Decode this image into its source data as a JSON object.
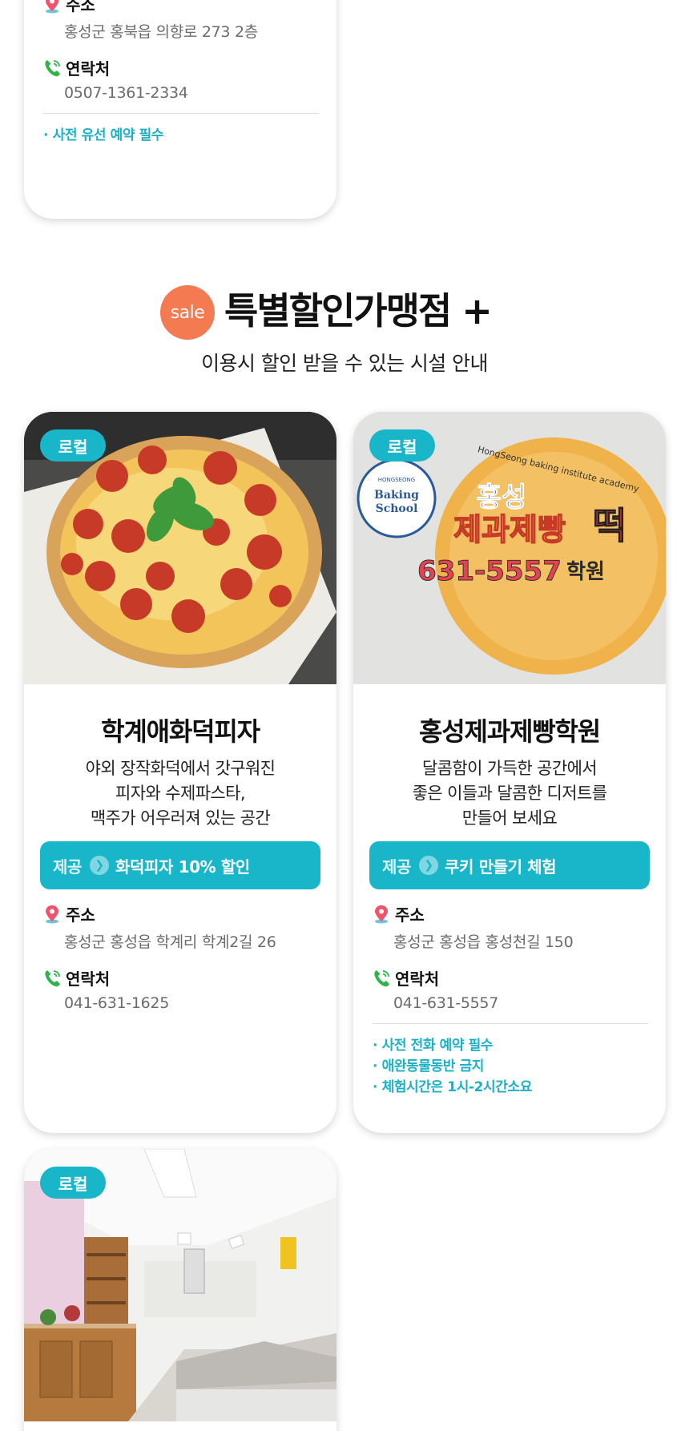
{
  "top_card": {
    "address_label": "주소",
    "address": "홍성군 홍북읍 의향로 273 2층",
    "contact_label": "연락처",
    "phone": "0507-1361-2334",
    "notes": [
      "· 사전 유선 예약 필수"
    ]
  },
  "section": {
    "badge": "sale",
    "title": "특별할인가맹점 +",
    "subtitle": "이용시 할인 받을 수 있는 시설 안내"
  },
  "cards": [
    {
      "tag": "로컬",
      "name": "학계애화덕피자",
      "description": "야외 장작화덕에서 갓구워진\n피자와 수제파스타,\n맥주가 어우러져 있는 공간",
      "benefit_label": "제공",
      "benefit": "화덕피자 10% 할인",
      "address_label": "주소",
      "address": "홍성군 홍성읍 학계리 학계2길 26",
      "contact_label": "연락처",
      "phone": "041-631-1625"
    },
    {
      "tag": "로컬",
      "name": "홍성제과제빵학원",
      "description": "달콤함이 가득한 공간에서\n좋은 이들과 달콤한 디저트를\n만들어 보세요",
      "benefit_label": "제공",
      "benefit": "쿠키 만들기 체험",
      "address_label": "주소",
      "address": "홍성군 홍성읍 홍성천길 150",
      "contact_label": "연락처",
      "phone": "041-631-5557",
      "notes": [
        "· 사전 전화 예약 필수",
        "· 애완동물동반 금지",
        "· 체험시간은 1시-2시간소요"
      ],
      "sign": {
        "top_text": "HongSeong baking institute academy",
        "logo_small": "HONGSEONG",
        "logo_line1": "Baking",
        "logo_line2": "School",
        "line1": "홍성",
        "line2": "제과제빵",
        "line2_accent": "떡",
        "phone": "631-5557",
        "suffix": "학원"
      }
    },
    {
      "tag": "로컬"
    }
  ],
  "colors": {
    "accent": "#19b6c9",
    "sale": "#f47a52",
    "note": "#1ab1c7"
  }
}
